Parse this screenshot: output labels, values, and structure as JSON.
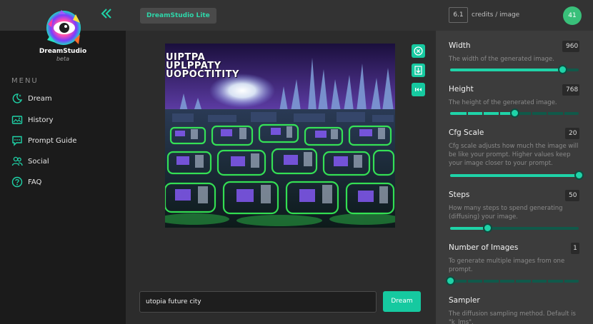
{
  "app": {
    "brand": "DreamStudio",
    "brand_sub": "beta",
    "badge": "DreamStudio Lite"
  },
  "sidebar": {
    "menu_label": "MENU",
    "items": [
      {
        "label": "Dream",
        "icon": "sparkle-moon-icon"
      },
      {
        "label": "History",
        "icon": "image-gallery-icon"
      },
      {
        "label": "Prompt Guide",
        "icon": "chat-bubble-icon"
      },
      {
        "label": "Social",
        "icon": "people-icon"
      },
      {
        "label": "FAQ",
        "icon": "question-circle-icon"
      }
    ]
  },
  "header": {
    "credits_value": "6.1",
    "credits_label": "credits / image",
    "avatar_text": "41"
  },
  "canvas": {
    "image_text_lines": [
      "UIPTPA",
      "UPLPPATY",
      "UOPOCTITITY"
    ],
    "tools": [
      "close-circle-icon",
      "download-icon",
      "skip-back-icon"
    ]
  },
  "prompt": {
    "value": "utopia future city",
    "button_label": "Dream"
  },
  "settings": [
    {
      "title": "Width",
      "value": "960",
      "description": "The width of the generated image.",
      "fraction": 0.87,
      "ticks": false
    },
    {
      "title": "Height",
      "value": "768",
      "description": "The height of the generated image.",
      "fraction": 0.5,
      "ticks": true
    },
    {
      "title": "Cfg Scale",
      "value": "20",
      "description": "Cfg scale adjusts how much the image will be like your prompt. Higher values keep your image closer to your prompt.",
      "fraction": 1.0,
      "ticks": false
    },
    {
      "title": "Steps",
      "value": "50",
      "description": "How many steps to spend generating (diffusing) your image.",
      "fraction": 0.29,
      "ticks": false
    },
    {
      "title": "Number of Images",
      "value": "1",
      "description": "To generate multiple images from one prompt.",
      "fraction": 0.0,
      "ticks": true
    },
    {
      "title": "Sampler",
      "description": "The diffusion sampling method. Default is \"k_lms\"."
    }
  ],
  "colors": {
    "accent": "#1fd3a8",
    "button": "#16c9a0",
    "avatar": "#39c07a",
    "sidebar_bg": "#1b1b1b",
    "panel_bg": "#3c3c3c"
  }
}
